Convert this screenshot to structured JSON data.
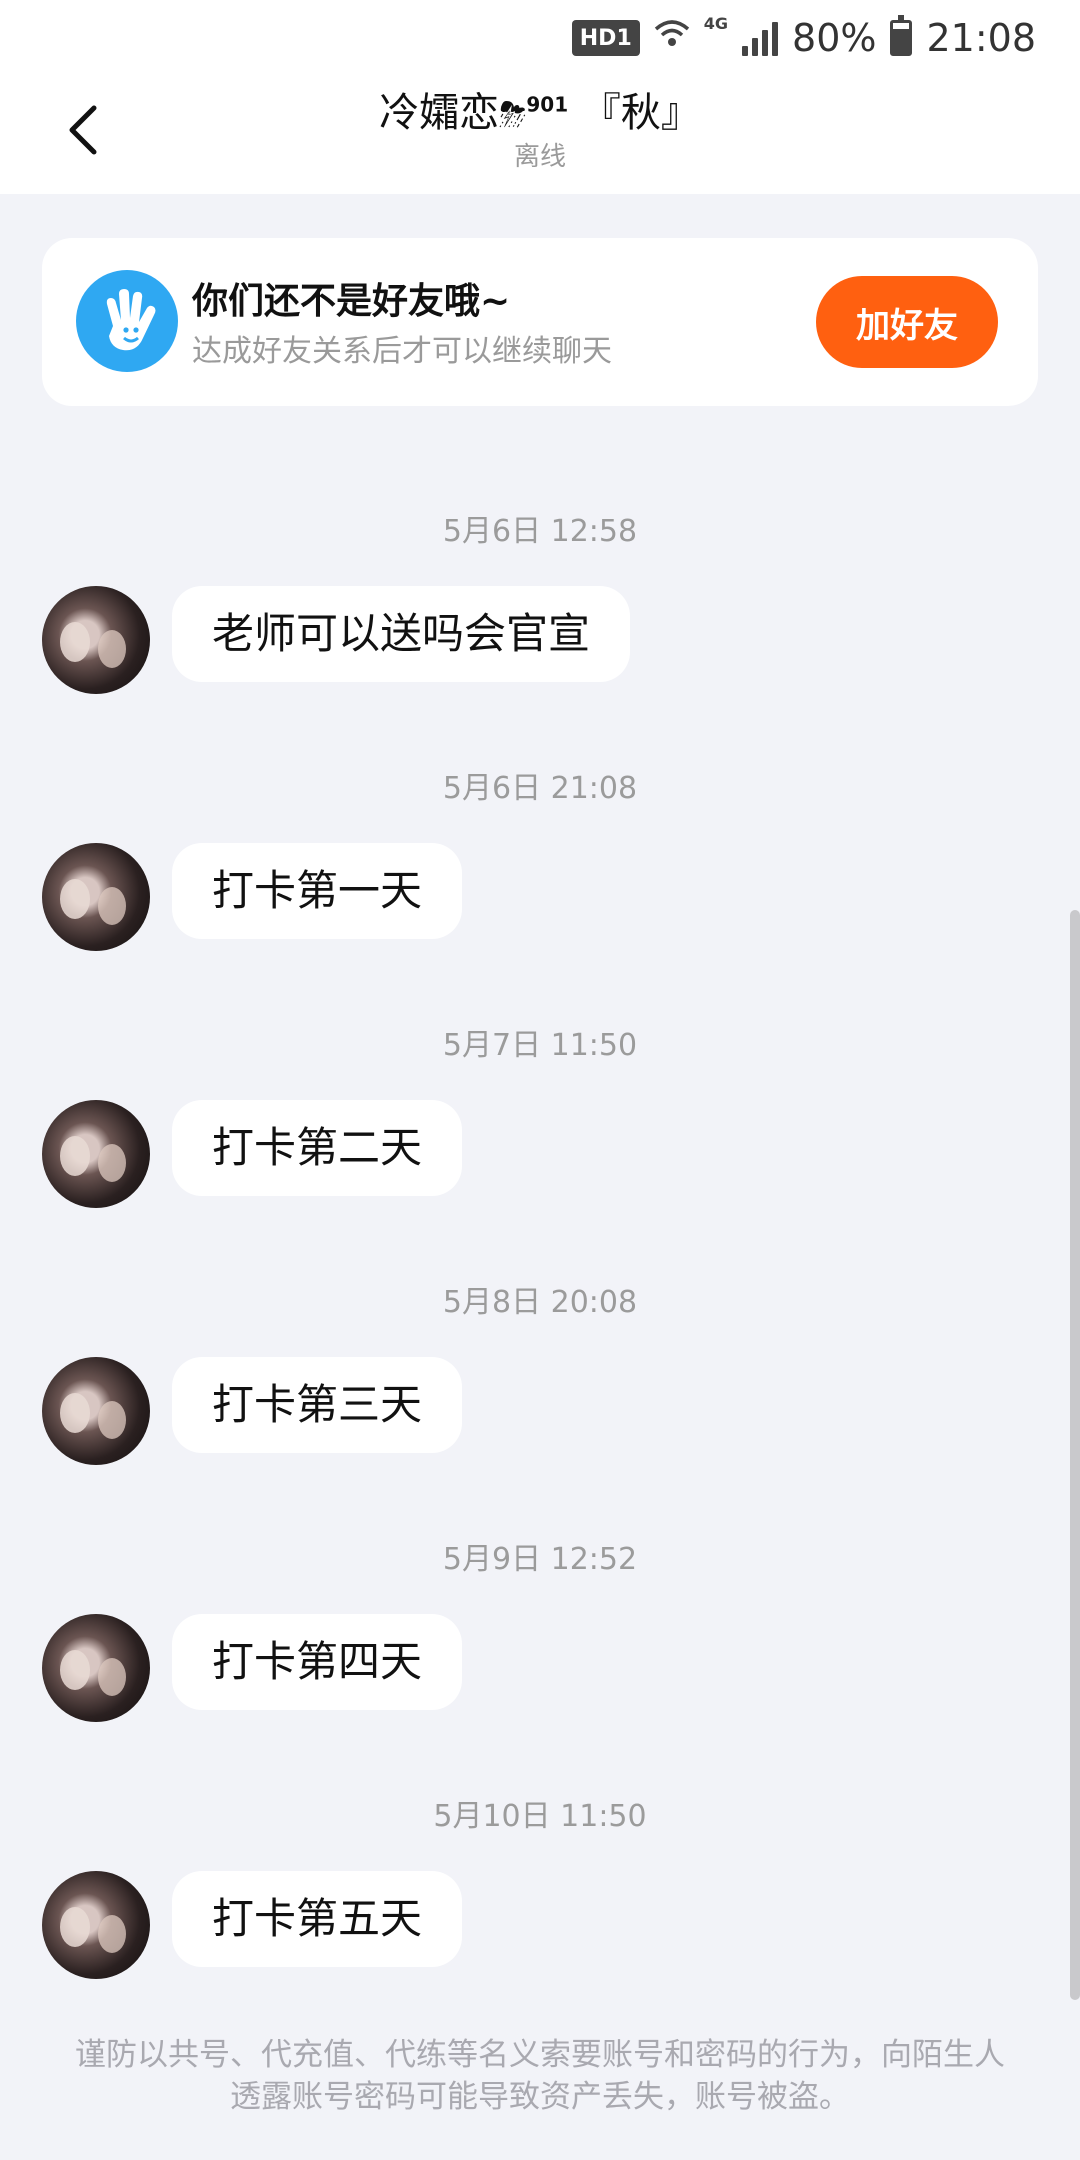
{
  "status_bar": {
    "hd": "HD1",
    "network": "4G",
    "battery": "80%",
    "time": "21:08"
  },
  "header": {
    "title": "冷孀恋",
    "title_emoji": "⛈",
    "title_sup": "901",
    "title_suffix": " 『秋』",
    "status": "离线"
  },
  "friend_card": {
    "title": "你们还不是好友哦~",
    "subtitle": "达成好友关系后才可以继续聊天",
    "add_button": "加好友",
    "icon_color": "#2fa8f2",
    "button_color": "#ff6010"
  },
  "messages": [
    {
      "time": "5月6日 12:58",
      "text": "老师可以送吗会官宣"
    },
    {
      "time": "5月6日 21:08",
      "text": "打卡第一天"
    },
    {
      "time": "5月7日 11:50",
      "text": "打卡第二天"
    },
    {
      "time": "5月8日 20:08",
      "text": "打卡第三天"
    },
    {
      "time": "5月9日 12:52",
      "text": "打卡第四天"
    },
    {
      "time": "5月10日 11:50",
      "text": "打卡第五天"
    }
  ],
  "warning": "谨防以共号、代充值、代练等名义索要账号和密码的行为，向陌生人透露账号密码可能导致资产丢失，账号被盗。"
}
